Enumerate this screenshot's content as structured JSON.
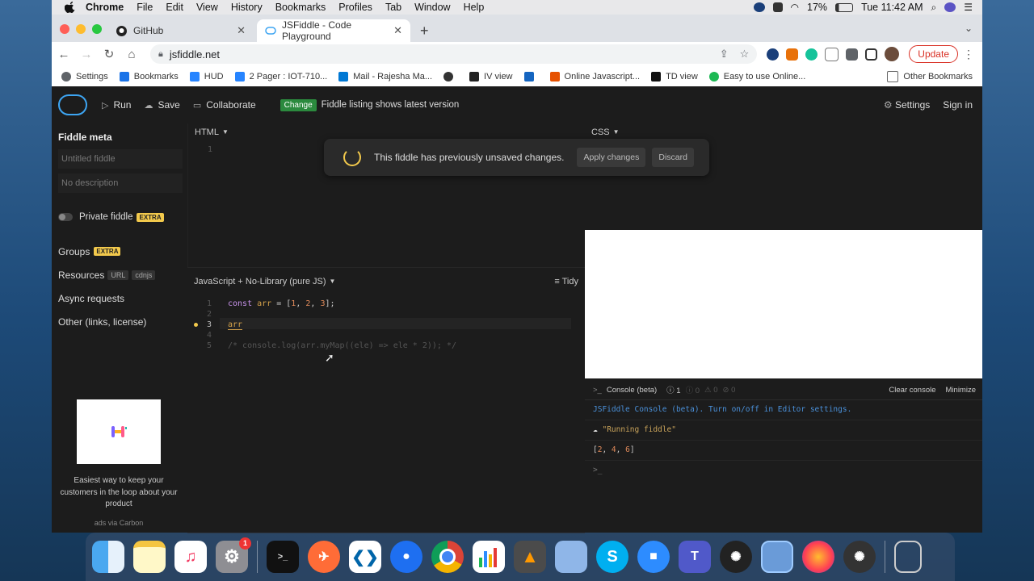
{
  "menubar": {
    "apple": "",
    "items": [
      "Chrome",
      "File",
      "Edit",
      "View",
      "History",
      "Bookmarks",
      "Profiles",
      "Tab",
      "Window",
      "Help"
    ],
    "battery": "17%",
    "clock": "Tue 11:42 AM"
  },
  "browser": {
    "tabs": [
      {
        "title": "GitHub",
        "icon": "github-icon"
      },
      {
        "title": "JSFiddle - Code Playground",
        "icon": "jsfiddle-icon"
      }
    ],
    "url": "jsfiddle.net",
    "update_label": "Update",
    "bookmarks": [
      "Settings",
      "Bookmarks",
      "HUD",
      "2 Pager : IOT-710...",
      "Mail - Rajesha Ma...",
      "",
      "IV view",
      "",
      "Online Javascript...",
      "TD view",
      "Easy to use Online..."
    ],
    "other_bookmarks": "Other Bookmarks"
  },
  "jsfiddle": {
    "run": "Run",
    "save": "Save",
    "collaborate": "Collaborate",
    "change_badge": "Change",
    "change_text": "Fiddle listing shows latest version",
    "settings": "Settings",
    "sign_in": "Sign in",
    "sidebar": {
      "meta_title": "Fiddle meta",
      "title_placeholder": "Untitled fiddle",
      "desc_placeholder": "No description",
      "private": "Private fiddle",
      "extra": "EXTRA",
      "groups": "Groups",
      "resources": "Resources",
      "url_chip": "URL",
      "cdnjs_chip": "cdnjs",
      "async": "Async requests",
      "other": "Other (links, license)",
      "ad_text": "Easiest way to keep your customers in the loop about your product",
      "ad_via": "ads via Carbon"
    },
    "html_panel": {
      "label": "HTML",
      "line": "1"
    },
    "css_panel": {
      "label": "CSS"
    },
    "js_panel": {
      "label": "JavaScript + No-Library (pure JS)",
      "tidy": "Tidy",
      "lines": [
        "1",
        "2",
        "3",
        "4",
        "5"
      ]
    },
    "code": {
      "line1_kw": "const",
      "line1_var": "arr",
      "line1_rest_a": " = [",
      "n1": "1",
      "n2": "2",
      "n3": "3",
      "comma": ", ",
      "line1_end": "];",
      "line3": "arr",
      "line5": "/* console.log(arr.myMap((ele) => ele * 2)); */"
    },
    "overlay": {
      "message": "This fiddle has previously unsaved changes.",
      "apply": "Apply changes",
      "discard": "Discard"
    },
    "console": {
      "title": "Console (beta)",
      "counts": [
        "1",
        "0",
        "0",
        "0"
      ],
      "clear": "Clear console",
      "minimize": "Minimize",
      "intro": "JSFiddle Console (beta). Turn on/off in Editor settings.",
      "running": "\"Running fiddle\"",
      "output_open": "[",
      "out1": "2",
      "out2": "4",
      "out3": "6",
      "output_close": "]",
      "prompt": ">_"
    }
  },
  "dock": {
    "items": [
      "finder",
      "notes",
      "music",
      "system-preferences",
      "terminal",
      "postman",
      "vscode",
      "maps",
      "chrome",
      "numbers",
      "sublime",
      "preview",
      "skype",
      "zoom",
      "teams",
      "app",
      "preview2",
      "firefox",
      "app2",
      "trash"
    ],
    "settings_badge": "1"
  },
  "colors": {
    "accent": "#3da5f2",
    "change": "#2b8a3e",
    "extra": "#f2c94c",
    "update": "#d93025"
  }
}
